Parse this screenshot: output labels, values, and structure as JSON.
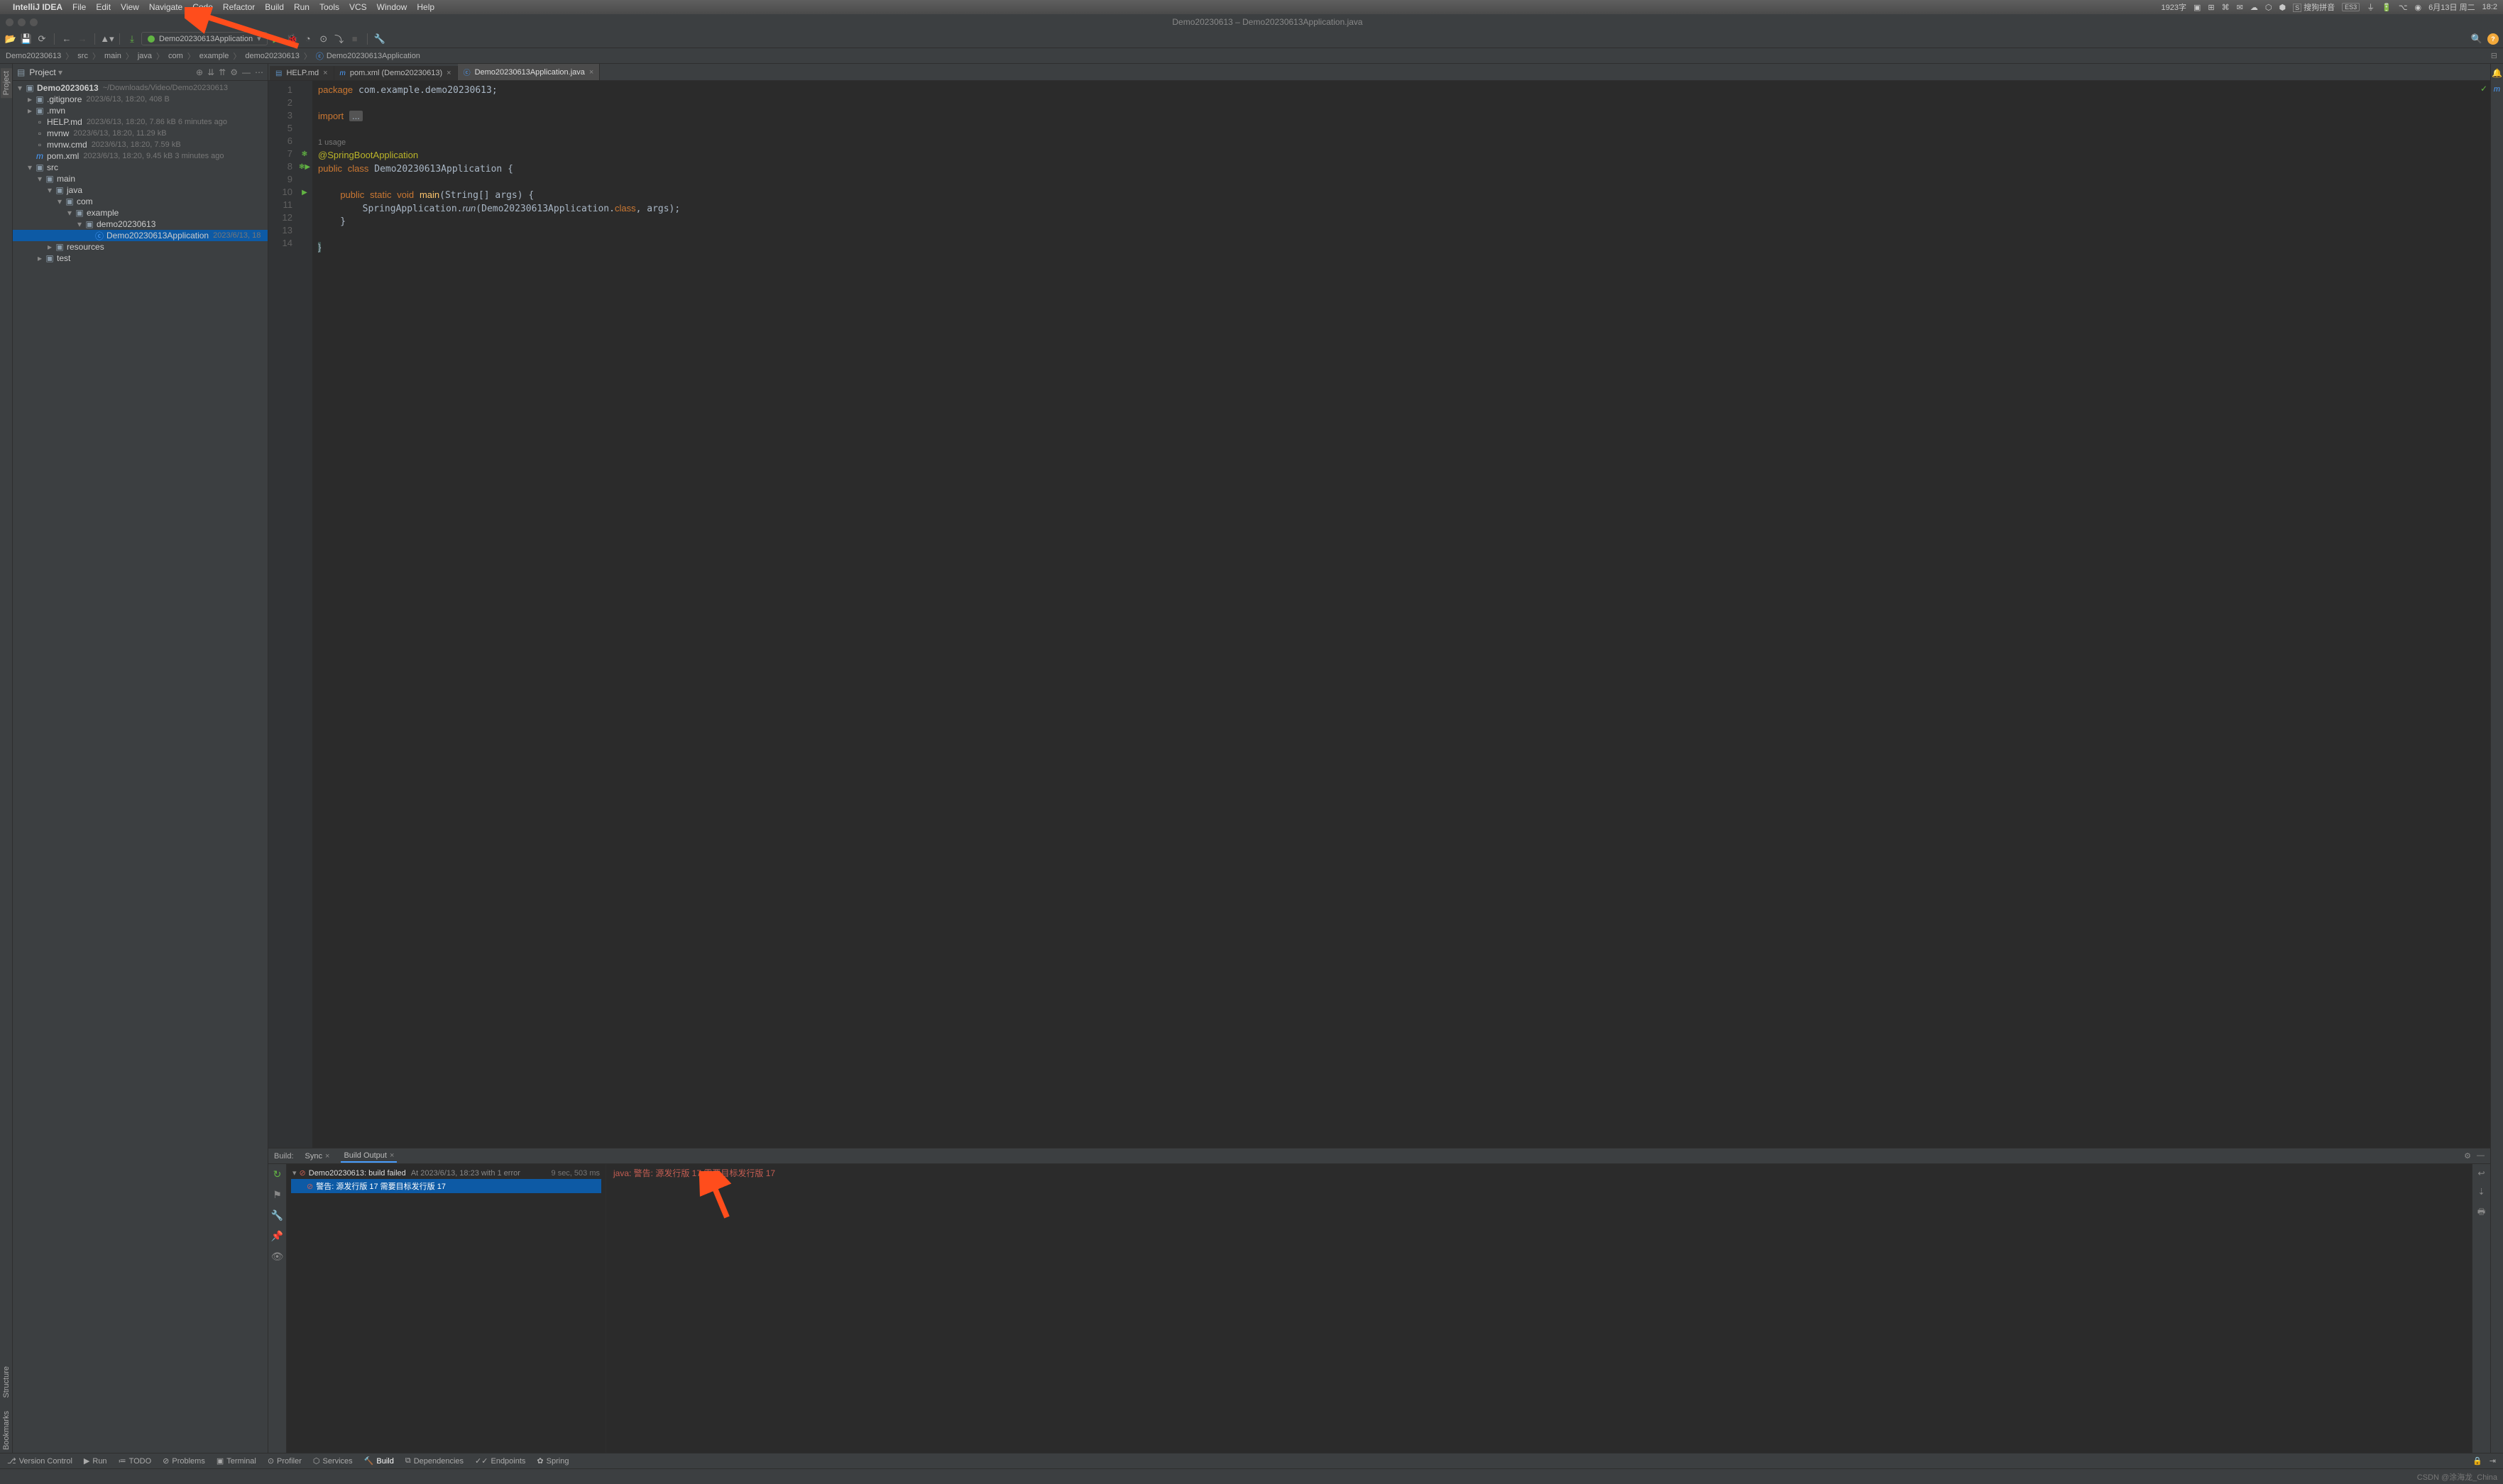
{
  "mac": {
    "app": "IntelliJ IDEA",
    "menus": [
      "File",
      "Edit",
      "View",
      "Navigate",
      "Code",
      "Refactor",
      "Build",
      "Run",
      "Tools",
      "VCS",
      "Window",
      "Help"
    ],
    "right": {
      "char_count": "1923字",
      "ime": "搜狗拼音",
      "ime_badge": "ES3",
      "date": "6月13日 周二",
      "time": "18:2"
    }
  },
  "window": {
    "title": "Demo20230613 – Demo20230613Application.java"
  },
  "runconfig": {
    "name": "Demo20230613Application"
  },
  "breadcrumb": [
    "Demo20230613",
    "src",
    "main",
    "java",
    "com",
    "example",
    "demo20230613",
    "Demo20230613Application"
  ],
  "project": {
    "header": "Project",
    "root": {
      "name": "Demo20230613",
      "path": "~/Downloads/Video/Demo20230613"
    },
    "items": [
      {
        "depth": 1,
        "arrow": ">",
        "icon": "folder",
        "label": ".gitignore",
        "meta": "2023/6/13, 18:20, 408 B",
        "file": true
      },
      {
        "depth": 1,
        "arrow": ">",
        "icon": "folder",
        "label": ".mvn"
      },
      {
        "depth": 1,
        "arrow": "",
        "icon": "file",
        "label": "HELP.md",
        "meta": "2023/6/13, 18:20, 7.86 kB 6 minutes ago"
      },
      {
        "depth": 1,
        "arrow": "",
        "icon": "file",
        "label": "mvnw",
        "meta": "2023/6/13, 18:20, 11.29 kB"
      },
      {
        "depth": 1,
        "arrow": "",
        "icon": "file",
        "label": "mvnw.cmd",
        "meta": "2023/6/13, 18:20, 7.59 kB"
      },
      {
        "depth": 1,
        "arrow": "",
        "icon": "maven",
        "label": "pom.xml",
        "meta": "2023/6/13, 18:20, 9.45 kB 3 minutes ago"
      },
      {
        "depth": 1,
        "arrow": "v",
        "icon": "folder",
        "label": "src"
      },
      {
        "depth": 2,
        "arrow": "v",
        "icon": "folder",
        "label": "main"
      },
      {
        "depth": 3,
        "arrow": "v",
        "icon": "folder-src",
        "label": "java"
      },
      {
        "depth": 4,
        "arrow": "v",
        "icon": "folder",
        "label": "com"
      },
      {
        "depth": 5,
        "arrow": "v",
        "icon": "folder",
        "label": "example"
      },
      {
        "depth": 6,
        "arrow": "v",
        "icon": "folder",
        "label": "demo20230613"
      },
      {
        "depth": 7,
        "arrow": "",
        "icon": "java",
        "label": "Demo20230613Application",
        "meta": "2023/6/13, 18",
        "selected": true
      },
      {
        "depth": 3,
        "arrow": ">",
        "icon": "folder-res",
        "label": "resources"
      },
      {
        "depth": 2,
        "arrow": ">",
        "icon": "folder",
        "label": "test"
      }
    ]
  },
  "editor": {
    "tabs": [
      {
        "icon": "md",
        "label": "HELP.md"
      },
      {
        "icon": "maven",
        "label": "pom.xml (Demo20230613)"
      },
      {
        "icon": "java",
        "label": "Demo20230613Application.java",
        "active": true
      }
    ],
    "lines": [
      1,
      2,
      3,
      5,
      6,
      7,
      8,
      9,
      10,
      11,
      12,
      13,
      14
    ],
    "usage": "1 usage"
  },
  "build": {
    "label": "Build:",
    "tabs": {
      "sync": "Sync",
      "output": "Build Output"
    },
    "fail": {
      "name": "Demo20230613:",
      "status": "build failed",
      "at": "At 2023/6/13, 18:23 with 1 error",
      "timing": "9 sec, 503 ms"
    },
    "err_line": "警告: 源发行版 17 需要目标发行版 17",
    "output": "java: 警告: 源发行版 17 需要目标发行版 17"
  },
  "bottom": {
    "items": [
      "Version Control",
      "Run",
      "TODO",
      "Problems",
      "Terminal",
      "Profiler",
      "Services",
      "Build",
      "Dependencies",
      "Endpoints",
      "Spring"
    ],
    "icons": [
      "⎇",
      "▶",
      "≔",
      "⊘",
      "▣",
      "⊙",
      "⬡",
      "🔨",
      "⧉",
      "✓✓",
      "✿"
    ]
  },
  "status": {
    "left": "",
    "watermark": "CSDN @涂海龙_China"
  },
  "left_tabs": [
    "Project",
    "Structure",
    "Bookmarks"
  ]
}
